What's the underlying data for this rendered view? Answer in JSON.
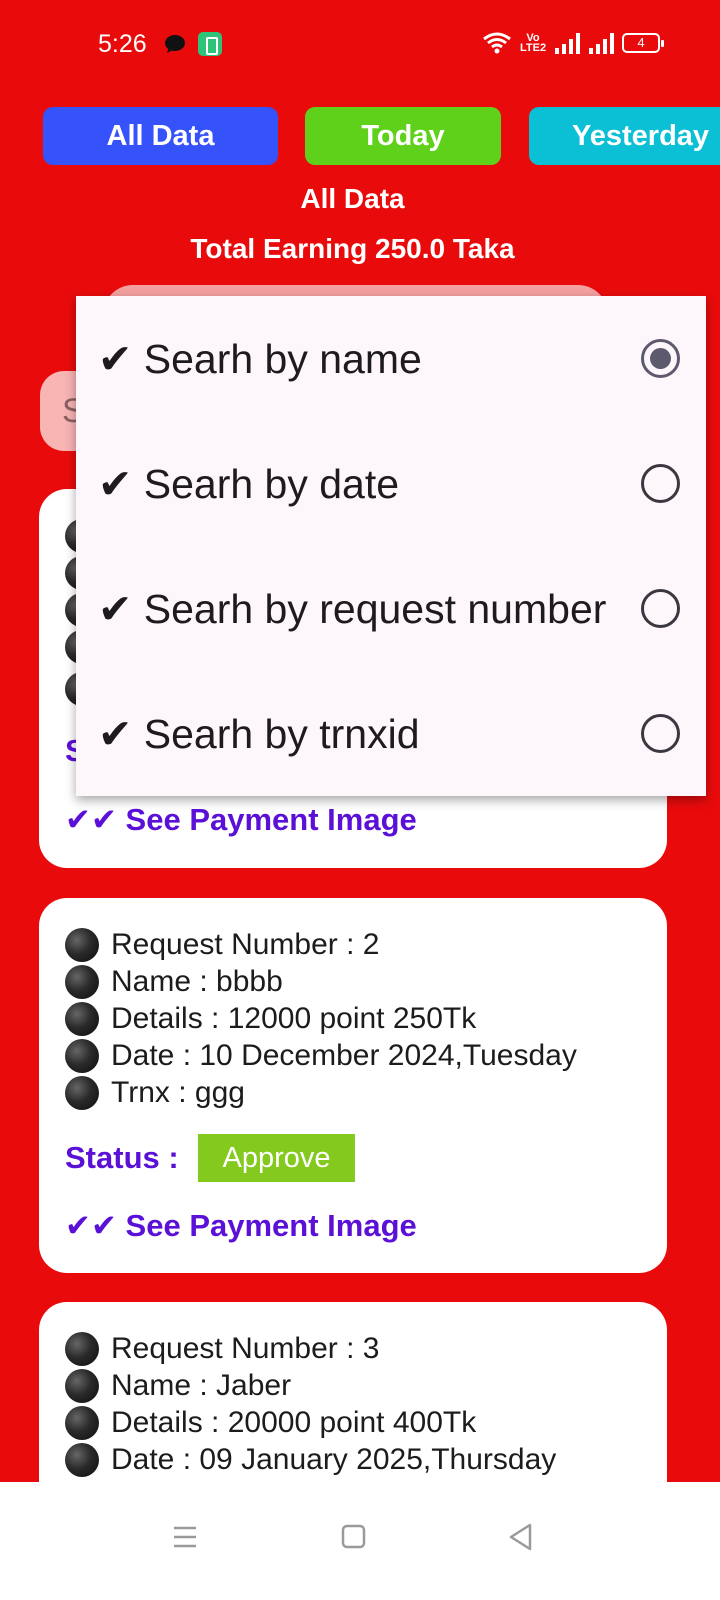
{
  "status_bar": {
    "time": "5:26",
    "volte": "Vo LTE2",
    "battery_level": "4"
  },
  "tabs": {
    "all": "All Data",
    "today": "Today",
    "yesterday": "Yesterday"
  },
  "header": {
    "filter_title": "All Data",
    "total_earning": "Total Earning 250.0 Taka"
  },
  "search": {
    "placeholder_visible": "S"
  },
  "menu": {
    "items": [
      {
        "label": "✔ Searh by name",
        "selected": true
      },
      {
        "label": "✔ Searh by date",
        "selected": false
      },
      {
        "label": "✔ Searh by request number",
        "selected": false
      },
      {
        "label": "✔ Searh by trnxid",
        "selected": false
      }
    ]
  },
  "cards": [
    {
      "status_partial": "S",
      "see_image": "✔✔ See Payment Image"
    },
    {
      "request_number": "Request Number :  2",
      "name": "Name :  bbbb",
      "details": "Details : 12000 point 250Tk",
      "date": "Date :  10 December 2024,Tuesday",
      "trnx": "Trnx :  ggg",
      "status_label": "Status :",
      "status_value": "Approve",
      "see_image": "✔✔ See Payment Image"
    },
    {
      "request_number": "Request Number :  3",
      "name": "Name :  Jaber",
      "details": "Details : 20000 point 400Tk",
      "date": "Date :  09 January 2025,Thursday"
    }
  ],
  "colors": {
    "background": "#e90b0c",
    "tab_all": "#3552fb",
    "tab_today": "#5fd11a",
    "tab_yesterday": "#0bbfd4",
    "status_text": "#5b10d8",
    "approve_chip": "#84c91d"
  },
  "nav": {
    "icons": [
      "menu-icon",
      "home-icon",
      "back-icon"
    ]
  }
}
